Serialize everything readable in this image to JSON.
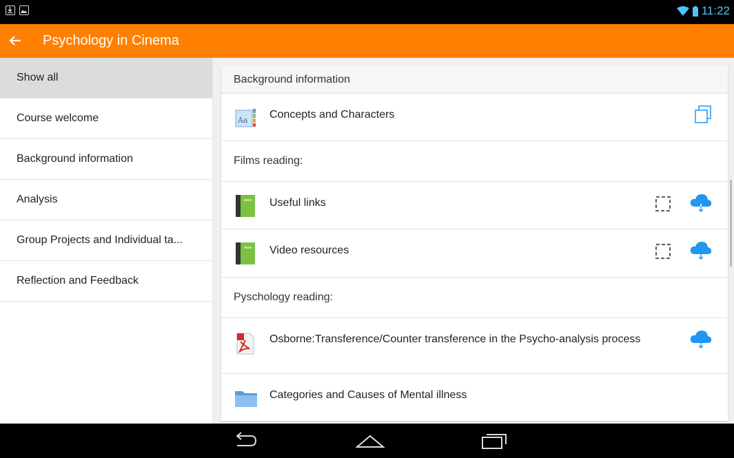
{
  "status": {
    "time": "11:22"
  },
  "appbar": {
    "title": "Psychology in Cinema"
  },
  "sidebar": {
    "items": [
      {
        "label": "Show all"
      },
      {
        "label": "Course welcome"
      },
      {
        "label": "Background information"
      },
      {
        "label": "Analysis"
      },
      {
        "label": "Group Projects and Individual ta..."
      },
      {
        "label": "Reflection and Feedback"
      }
    ]
  },
  "content": {
    "section_title": "Background information",
    "items": [
      {
        "label": "Concepts and Characters",
        "icon": "glossary-icon"
      },
      {
        "label": "Useful links",
        "icon": "book-icon"
      },
      {
        "label": "Video resources",
        "icon": "book-icon"
      },
      {
        "label": "Osborne:Transference/Counter transference in the Psycho-analysis process",
        "icon": "pdf-icon"
      },
      {
        "label": "Categories and Causes of Mental illness",
        "icon": "folder-icon"
      }
    ],
    "subheaders": [
      "Films reading:",
      "Pyschology reading:"
    ]
  },
  "colors": {
    "accent": "#ff8000",
    "status_accent": "#4fc3f7",
    "cloud": "#2196f3"
  }
}
